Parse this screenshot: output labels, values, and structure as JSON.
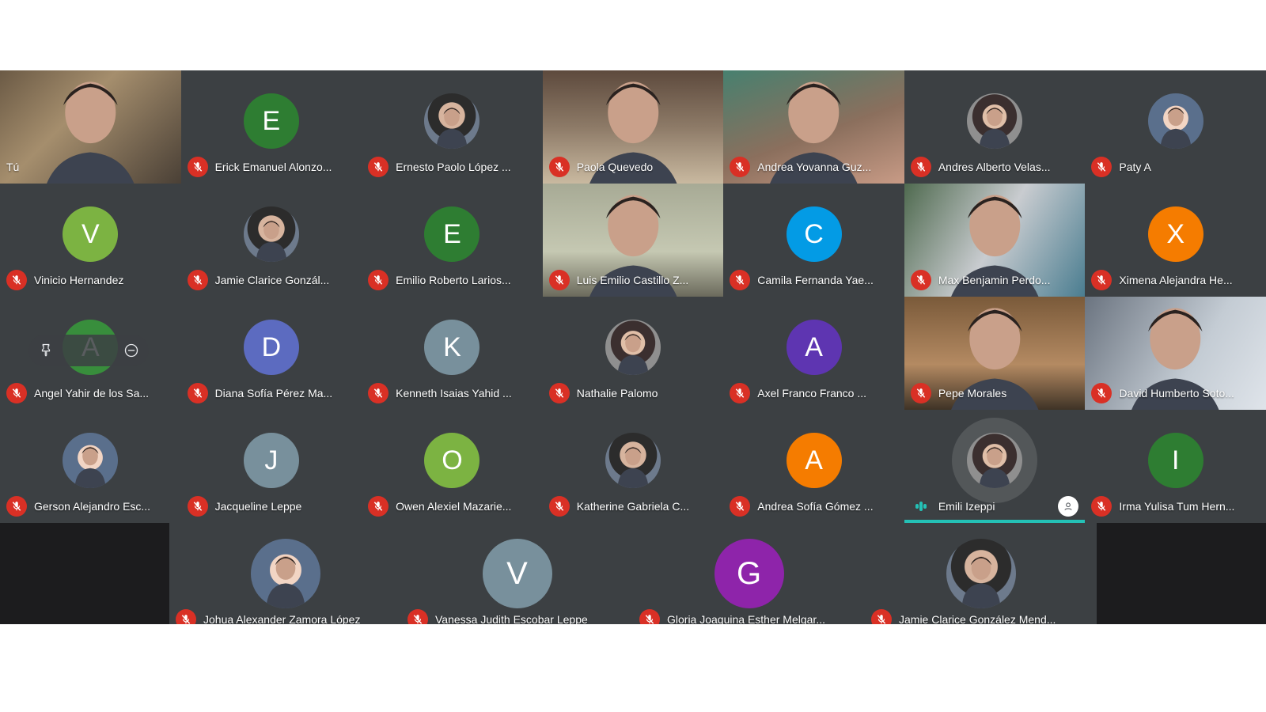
{
  "colors": {
    "background": "#202124",
    "tile": "#3c4043",
    "muted_badge": "#d93025",
    "active_speaker": "#24c1b6"
  },
  "participants": [
    {
      "name": "Tú",
      "type": "video",
      "muted": false
    },
    {
      "name": "Erick Emanuel Alonzo...",
      "type": "letter",
      "initial": "E",
      "color": "#2e7d32",
      "muted": true
    },
    {
      "name": "Ernesto Paolo López ...",
      "type": "photo",
      "muted": true
    },
    {
      "name": "Paola Quevedo",
      "type": "video",
      "muted": true
    },
    {
      "name": "Andrea Yovanna Guz...",
      "type": "video",
      "muted": true
    },
    {
      "name": "Andres Alberto Velas...",
      "type": "photo",
      "muted": true
    },
    {
      "name": "Paty A",
      "type": "photo",
      "muted": true
    },
    {
      "name": "Vinicio Hernandez",
      "type": "letter",
      "initial": "V",
      "color": "#7cb342",
      "muted": true
    },
    {
      "name": "Jamie Clarice Gonzál...",
      "type": "photo",
      "muted": true
    },
    {
      "name": "Emilio Roberto Larios...",
      "type": "letter",
      "initial": "E",
      "color": "#2e7d32",
      "muted": true
    },
    {
      "name": "Luis Emilio Castillo Z...",
      "type": "video",
      "muted": true
    },
    {
      "name": "Camila Fernanda Yae...",
      "type": "letter",
      "initial": "C",
      "color": "#039be5",
      "muted": true
    },
    {
      "name": "Max Benjamin Perdo...",
      "type": "video",
      "muted": true
    },
    {
      "name": "Ximena Alejandra He...",
      "type": "letter",
      "initial": "X",
      "color": "#f57c00",
      "muted": true
    },
    {
      "name": "Angel Yahir de los Sa...",
      "type": "letter",
      "initial": "A",
      "color": "#388e3c",
      "muted": true,
      "hover": true
    },
    {
      "name": "Diana Sofía Pérez Ma...",
      "type": "letter",
      "initial": "D",
      "color": "#5c6bc0",
      "muted": true
    },
    {
      "name": "Kenneth Isaias Yahid ...",
      "type": "letter",
      "initial": "K",
      "color": "#78909c",
      "muted": true
    },
    {
      "name": "Nathalie Palomo",
      "type": "photo",
      "muted": true
    },
    {
      "name": "Axel Franco Franco ...",
      "type": "letter",
      "initial": "A",
      "color": "#5e35b1",
      "muted": true
    },
    {
      "name": "Pepe Morales",
      "type": "video",
      "muted": true
    },
    {
      "name": "David Humberto Soto...",
      "type": "video",
      "muted": true
    },
    {
      "name": "Gerson Alejandro Esc...",
      "type": "photo",
      "muted": true
    },
    {
      "name": "Jacqueline Leppe",
      "type": "letter",
      "initial": "J",
      "color": "#78909c",
      "muted": true
    },
    {
      "name": "Owen Alexiel Mazarie...",
      "type": "letter",
      "initial": "O",
      "color": "#7cb342",
      "muted": true
    },
    {
      "name": "Katherine Gabriela C...",
      "type": "photo",
      "muted": true
    },
    {
      "name": "Andrea Sofía Gómez ...",
      "type": "letter",
      "initial": "A",
      "color": "#f57c00",
      "muted": true
    },
    {
      "name": "Emili Izeppi",
      "type": "photo",
      "muted": false,
      "speaking": true
    },
    {
      "name": "Irma Yulisa Tum Hern...",
      "type": "letter",
      "initial": "I",
      "color": "#2e7d32",
      "muted": true
    },
    {
      "name": "Johua Alexander Zamora López",
      "type": "photo",
      "muted": true
    },
    {
      "name": "Vanessa Judith Escobar Leppe",
      "type": "letter",
      "initial": "V",
      "color": "#78909c",
      "muted": true
    },
    {
      "name": "Gloria Joaquina Esther Melgar...",
      "type": "letter",
      "initial": "G",
      "color": "#8e24aa",
      "muted": true
    },
    {
      "name": "Jamie Clarice González Mend...",
      "type": "photo",
      "muted": true
    }
  ]
}
